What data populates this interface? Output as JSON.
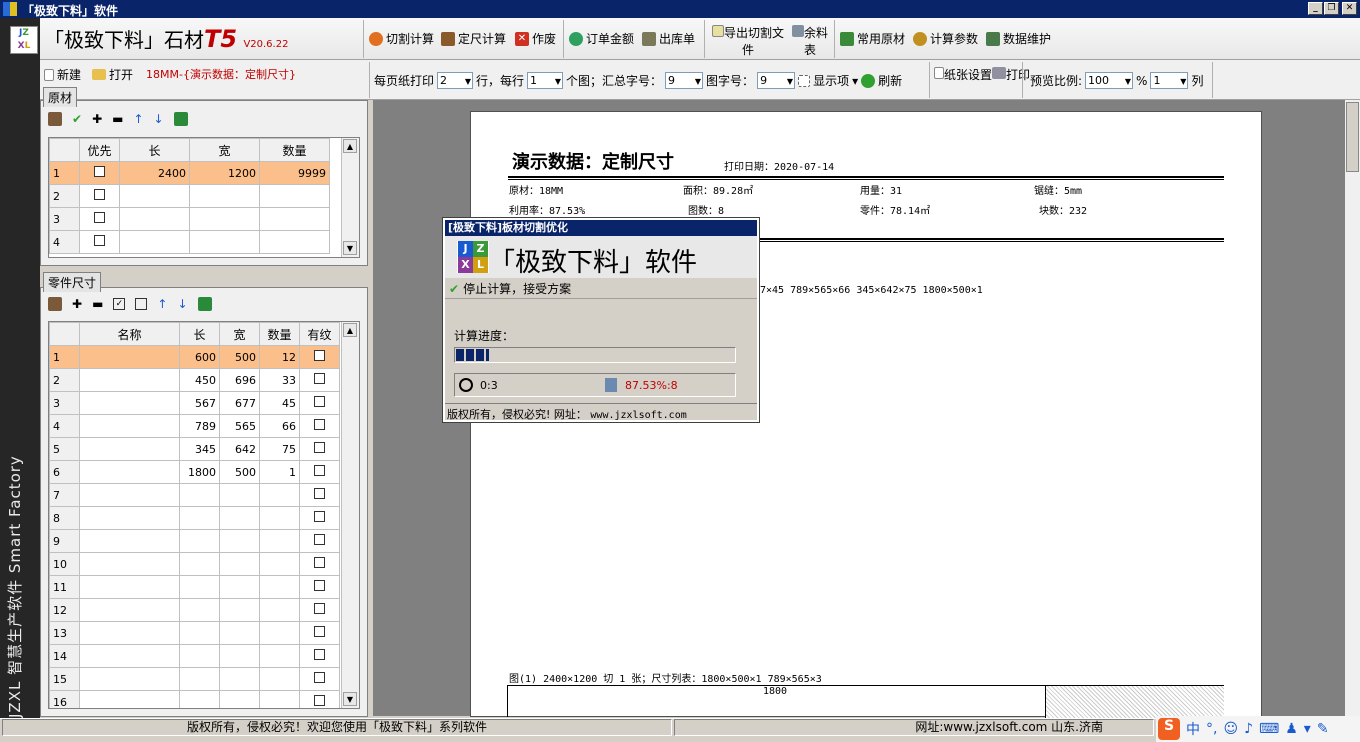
{
  "window": {
    "title": "「极致下料」软件"
  },
  "side": {
    "text": "JZXL 智慧生产软件 Smart Factory"
  },
  "logo": {
    "name": "「极致下料」石材",
    "model": "T5",
    "version": "V20.6.22"
  },
  "toolbar": {
    "cut_calc": "切割计算",
    "fixed_calc": "定尺计算",
    "void": "作废",
    "order_amount": "订单金额",
    "outbound": "出库单",
    "export_cut": "导出切割文件",
    "remnant": "余料表",
    "common_material": "常用原材",
    "calc_params": "计算参数",
    "data_maint": "数据维护"
  },
  "filebar": {
    "new": "新建",
    "open": "打开",
    "doc_title": "18MM-{演示数据：定制尺寸}"
  },
  "printbar": {
    "per_page_label": "每页纸打印",
    "per_page": "2",
    "rows_label": "行，每行",
    "per_row": "1",
    "per_row_suffix": "个图；汇总字号：",
    "sum_font": "9",
    "fig_font_label": "图字号：",
    "fig_font": "9",
    "display": "显示项",
    "refresh": "刷新",
    "page_setup": "纸张设置",
    "print": "打印",
    "ratio_label": "预览比例:",
    "ratio": "100",
    "percent": "%",
    "cols": "1",
    "cols_label": "列"
  },
  "materials": {
    "tab": "原材",
    "headers": [
      "优先",
      "长",
      "宽",
      "数量"
    ],
    "rows": [
      {
        "n": "1",
        "len": "2400",
        "wid": "1200",
        "qty": "9999"
      },
      {
        "n": "2",
        "len": "",
        "wid": "",
        "qty": ""
      },
      {
        "n": "3",
        "len": "",
        "wid": "",
        "qty": ""
      },
      {
        "n": "4",
        "len": "",
        "wid": "",
        "qty": ""
      }
    ]
  },
  "parts": {
    "tab": "零件尺寸",
    "headers": [
      "名称",
      "长",
      "宽",
      "数量",
      "有纹"
    ],
    "rows": [
      {
        "n": "1",
        "name": "",
        "len": "600",
        "wid": "500",
        "qty": "12"
      },
      {
        "n": "2",
        "name": "",
        "len": "450",
        "wid": "696",
        "qty": "33"
      },
      {
        "n": "3",
        "name": "",
        "len": "567",
        "wid": "677",
        "qty": "45"
      },
      {
        "n": "4",
        "name": "",
        "len": "789",
        "wid": "565",
        "qty": "66"
      },
      {
        "n": "5",
        "name": "",
        "len": "345",
        "wid": "642",
        "qty": "75"
      },
      {
        "n": "6",
        "name": "",
        "len": "1800",
        "wid": "500",
        "qty": "1"
      },
      {
        "n": "7"
      },
      {
        "n": "8"
      },
      {
        "n": "9"
      },
      {
        "n": "10"
      },
      {
        "n": "11"
      },
      {
        "n": "12"
      },
      {
        "n": "13"
      },
      {
        "n": "14"
      },
      {
        "n": "15"
      },
      {
        "n": "16"
      }
    ]
  },
  "report": {
    "title": "演示数据：定制尺寸",
    "print_date": "打印日期：2020-07-14",
    "material": "原材：18MM",
    "area": "面积：89.28㎡",
    "usage": "用量：31",
    "kerf": "锯缝：5mm",
    "utilization": "利用率：87.53%",
    "figures": "图数：8",
    "parts_area": "零件：78.14㎡",
    "pieces": "块数：232",
    "sizes_visible": "7×45      789×565×66      345×642×75      1800×500×1",
    "fig1": "图(1) 2400×1200 切 1 张；尺寸列表：1800×500×1 789×565×3",
    "fig1_dim": "1800"
  },
  "dialog": {
    "title": "[极致下料]板材切割优化",
    "brand": "「极致下料」软件",
    "stop": "停止计算，接受方案",
    "progress_label": "计算进度：",
    "progress": 0.12,
    "time": "0:3",
    "rate": "87.53%:8",
    "footer": "版权所有，侵权必究!  网址：",
    "url": "www.jzxlsoft.com"
  },
  "status": {
    "left": "版权所有，侵权必究！欢迎您使用「极致下料」系列软件",
    "right": "网址:www.jzxlsoft.com 山东.济南",
    "ime": "中"
  }
}
